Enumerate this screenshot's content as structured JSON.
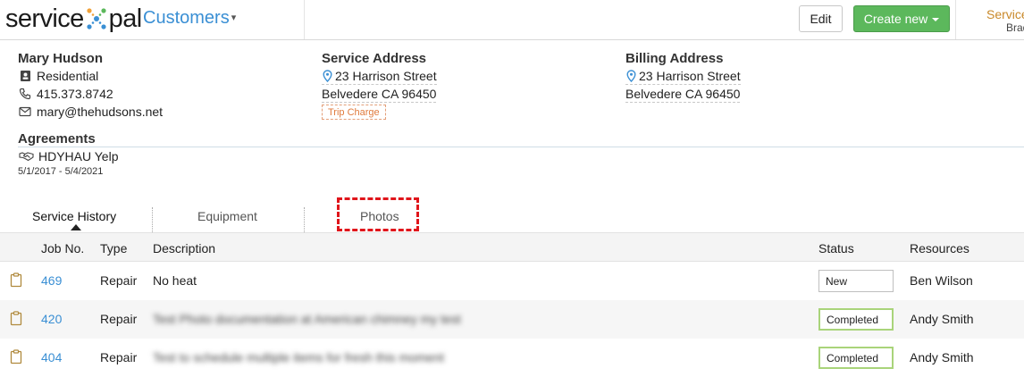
{
  "app": {
    "logo_left": "service",
    "logo_right": "pal",
    "section": "Customers",
    "edit_label": "Edit",
    "create_label": "Create new",
    "account_title": "Service",
    "account_sub": "Brad"
  },
  "customer": {
    "name": "Mary Hudson",
    "type": "Residential",
    "phone": "415.373.8742",
    "email": "mary@thehudsons.net"
  },
  "service_address": {
    "title": "Service Address",
    "street": "23 Harrison Street",
    "city": "Belvedere CA 96450",
    "tag": "Trip Charge"
  },
  "billing_address": {
    "title": "Billing Address",
    "street": "23 Harrison Street",
    "city": "Belvedere CA 96450"
  },
  "agreements": {
    "title": "Agreements",
    "name": "HDYHAU Yelp",
    "dates": "5/1/2017 - 5/4/2021"
  },
  "tabs": [
    "Service History",
    "Equipment",
    "Photos"
  ],
  "table": {
    "headers": [
      "Job No.",
      "Type",
      "Description",
      "Status",
      "Resources"
    ],
    "rows": [
      {
        "job": "469",
        "type": "Repair",
        "description": "No heat",
        "status": "New",
        "resource": "Ben Wilson"
      },
      {
        "job": "420",
        "type": "Repair",
        "description": "Test Photo documentation at American chimney my test",
        "status": "Completed",
        "resource": "Andy Smith"
      },
      {
        "job": "404",
        "type": "Repair",
        "description": "Test to schedule multiple items for fresh this moment",
        "status": "Completed",
        "resource": "Andy Smith"
      }
    ]
  },
  "colors": {
    "accent": "#3a8fd4",
    "create_button": "#5cb85c",
    "trip_tag": "#e07a3c",
    "highlight": "#e0151b",
    "status_completed_border": "#a9d47a"
  },
  "icons": {
    "type": "id-card-icon",
    "phone": "phone-icon",
    "email": "envelope-icon",
    "address": "map-pin-icon",
    "agreement": "handshake-icon",
    "job": "clipboard-icon"
  }
}
